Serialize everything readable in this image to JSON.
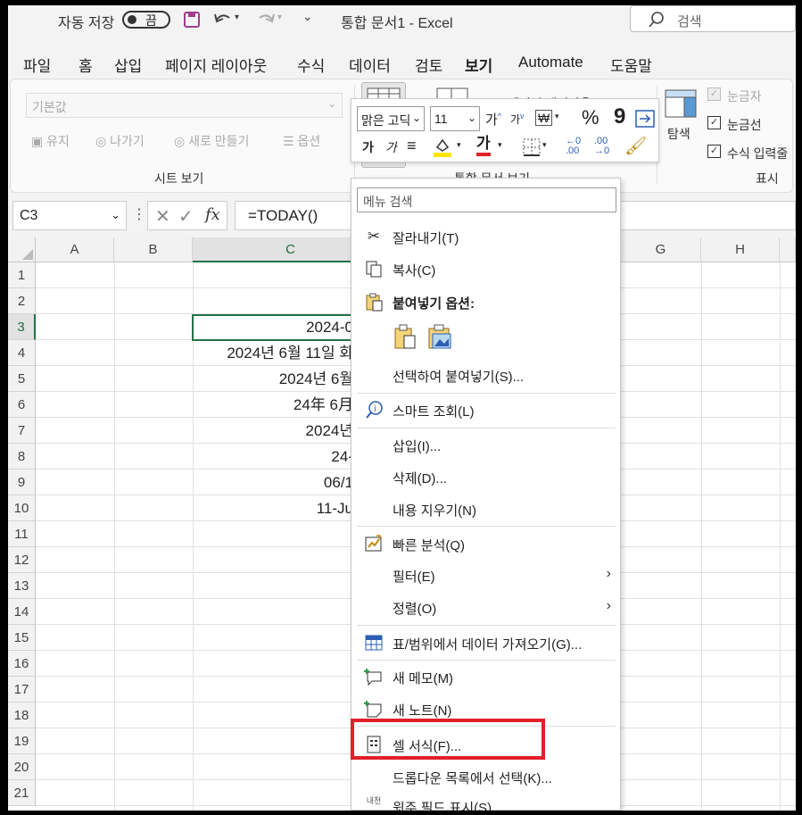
{
  "titlebar": {
    "autosave_label": "자동 저장",
    "autosave_state": "끔",
    "title": "통합 문서1 - Excel",
    "search_placeholder": "검색"
  },
  "tabs": [
    "파일",
    "홈",
    "삽입",
    "페이지 레이아웃",
    "수식",
    "데이터",
    "검토",
    "보기",
    "Automate",
    "도움말"
  ],
  "active_tab": "보기",
  "ribbon": {
    "sheet_view_dropdown": "기본값",
    "keep": "유지",
    "exit": "나가기",
    "new": "새로 만들기",
    "options": "옵션",
    "group_sheet_view": "시트 보기",
    "group_workbook_view": "통합 문서 보기",
    "navigation": "탐색",
    "ruler": "눈금자",
    "gridlines": "눈금선",
    "formula_bar": "수식 입력줄",
    "group_show": "표시",
    "page_layout_partial": "페이지 레이아웃"
  },
  "mini_toolbar": {
    "font_name": "맑은 고딕",
    "font_size": "11",
    "grow": "가",
    "shrink": "가",
    "percent": "%",
    "comma": "9",
    "bold": "가",
    "italic": "가",
    "font_color_letter": "가",
    "font_color": "#e0202a",
    "fill_color": "#ffe600"
  },
  "formula_bar": {
    "name_box": "C3",
    "formula": "=TODAY()"
  },
  "columns": [
    "A",
    "B",
    "C",
    "G",
    "H"
  ],
  "rows": [
    "1",
    "2",
    "3",
    "4",
    "5",
    "6",
    "7",
    "8",
    "9",
    "10",
    "11",
    "12",
    "13",
    "14",
    "15",
    "16",
    "17",
    "18",
    "19",
    "20",
    "21"
  ],
  "cells_C": [
    "",
    "",
    "2024-0",
    "2024년 6월 11일 화",
    "2024년 6월",
    "24年 6月",
    "2024년",
    "24-",
    "06/1",
    "11-Ju",
    "",
    "",
    "",
    "",
    "",
    "",
    "",
    "",
    "",
    "",
    ""
  ],
  "context_menu": {
    "search_placeholder": "메뉴 검색",
    "items": [
      {
        "label": "잘라내기(T)",
        "icon": "scissors-icon"
      },
      {
        "label": "복사(C)",
        "icon": "copy-icon"
      },
      {
        "label": "붙여넣기 옵션:",
        "icon": "paste-icon"
      },
      {
        "label": "선택하여 붙여넣기(S)...",
        "icon": ""
      },
      {
        "label": "스마트 조회(L)",
        "icon": "smart-lookup-icon"
      },
      {
        "label": "삽입(I)...",
        "icon": ""
      },
      {
        "label": "삭제(D)...",
        "icon": ""
      },
      {
        "label": "내용 지우기(N)",
        "icon": ""
      },
      {
        "label": "빠른 분석(Q)",
        "icon": "quick-analysis-icon"
      },
      {
        "label": "필터(E)",
        "icon": ""
      },
      {
        "label": "정렬(O)",
        "icon": ""
      },
      {
        "label": "표/범위에서 데이터 가져오기(G)...",
        "icon": "table-icon"
      },
      {
        "label": "새 메모(M)",
        "icon": "new-comment-icon"
      },
      {
        "label": "새 노트(N)",
        "icon": "new-note-icon"
      },
      {
        "label": "셀 서식(F)...",
        "icon": "format-cells-icon"
      },
      {
        "label": "드롭다운 목록에서 선택(K)...",
        "icon": ""
      },
      {
        "label": "윗주 필드 표시(S)",
        "icon": "phonetic-icon"
      }
    ],
    "phonetic_icon_text": "내천"
  },
  "colors": {
    "accent_green": "#217346",
    "highlight_red": "#e0202a"
  }
}
